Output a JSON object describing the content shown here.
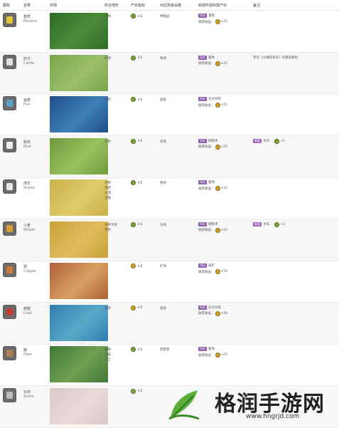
{
  "header": {
    "icon": "图标",
    "name": "名称",
    "appearance": "外观",
    "terrain": "所在地形",
    "yield": "产出指标",
    "improvement": "对应改良设施",
    "tech": "收获所需科技产出",
    "note": "备注"
  },
  "rows": [
    {
      "cn": "香蕉",
      "en": "Banana",
      "terrain": [
        "雨林"
      ],
      "yield": "+1",
      "improvement": "种植园",
      "tech_tag": "科技",
      "tech": "灌溉",
      "harvest": "收获收益：",
      "harvest_val": "+25",
      "note_tag": "",
      "note": "",
      "note_val": "",
      "icon_color": "#e6c630",
      "thumb": [
        "#2f6b2a",
        "#4d8b3a"
      ]
    },
    {
      "cn": "奶牛",
      "en": "Cattle",
      "terrain": [
        "草原"
      ],
      "yield": "+1",
      "improvement": "牧场",
      "tech_tag": "科技",
      "tech": "畜牧",
      "harvest": "收获收益：",
      "harvest_val": "+25",
      "note_tag": "",
      "note": "参见《大潮四号年》的建造教程",
      "note_val": "",
      "icon_color": "#e0e0e0",
      "thumb": [
        "#7aa54a",
        "#9bbf6a"
      ]
    },
    {
      "cn": "鱼群",
      "en": "Fish",
      "terrain": [
        "海岸"
      ],
      "yield": "+1",
      "improvement": "渔船",
      "tech_tag": "科技",
      "tech": "天文导航",
      "harvest": "收获收益：",
      "harvest_val": "+25",
      "note_tag": "",
      "note": "",
      "note_val": "",
      "icon_color": "#5aa0c8",
      "thumb": [
        "#1f4f8a",
        "#3e7fb8"
      ]
    },
    {
      "cn": "稻米",
      "en": "Rice",
      "terrain": [
        "草原"
      ],
      "yield": "+1",
      "improvement": "农场",
      "tech_tag": "科技",
      "tech": "制陶术",
      "harvest": "收获收益：",
      "harvest_val": "+25",
      "note_tag": "新版",
      "note": "水车：",
      "note_val": "+1",
      "icon_color": "#f0f0f0",
      "thumb": [
        "#6f9a3c",
        "#98c060"
      ]
    },
    {
      "cn": "绵羊",
      "en": "Sheep",
      "terrain": [
        "平原",
        "草原",
        "沙漠",
        "丘陵"
      ],
      "yield": "+1",
      "improvement": "牧场",
      "tech_tag": "科技",
      "tech": "畜牧",
      "harvest": "收获收益：",
      "harvest_val": "+25",
      "note_tag": "",
      "note": "",
      "note_val": "",
      "icon_color": "#e8e8e8",
      "thumb": [
        "#c9b04a",
        "#e0cb6a"
      ]
    },
    {
      "cn": "小麦",
      "en": "Wheat",
      "terrain": [
        "冲积平原",
        "平原"
      ],
      "yield": "+1",
      "improvement": "农场",
      "tech_tag": "科技",
      "tech": "制陶术",
      "harvest": "收获收益：",
      "harvest_val": "+25",
      "note_tag": "新版",
      "note": "水车：",
      "note_val": "+1",
      "icon_color": "#d8a030",
      "thumb": [
        "#c9a13a",
        "#e0bc5a"
      ]
    },
    {
      "cn": "铜",
      "en": "Copper",
      "terrain": [],
      "yield": "+2",
      "improvement": "矿场",
      "tech_tag": "科技",
      "tech": "采矿",
      "harvest": "收获收益：",
      "harvest_val": "+50",
      "note_tag": "",
      "note": "",
      "note_val": "",
      "icon_color": "#d07a40",
      "thumb": [
        "#b0603a",
        "#d8a060"
      ]
    },
    {
      "cn": "螃蟹",
      "en": "Crab",
      "terrain": [
        "海岸"
      ],
      "yield": "+2",
      "improvement": "渔船",
      "tech_tag": "科技",
      "tech": "天文导航",
      "harvest": "收获收益：",
      "harvest_val": "+50",
      "note_tag": "",
      "note": "",
      "note_val": "",
      "icon_color": "#c83a30",
      "thumb": [
        "#2f7fb0",
        "#5aa8c8"
      ]
    },
    {
      "cn": "鹿",
      "en": "Deer",
      "terrain": [
        "森林",
        "丘陵",
        "冻土"
      ],
      "yield": "+1",
      "improvement": "狩猎营",
      "tech_tag": "科技",
      "tech": "畜牧",
      "harvest": "收获收益：",
      "harvest_val": "+25",
      "note_tag": "",
      "note": "",
      "note_val": "",
      "icon_color": "#b08050",
      "thumb": [
        "#3f7a3a",
        "#6fa050"
      ]
    },
    {
      "cn": "石材",
      "en": "Stone",
      "terrain": [],
      "yield": "+1",
      "improvement": "",
      "tech_tag": "",
      "tech": "",
      "harvest": "",
      "harvest_val": "",
      "note_tag": "",
      "note": "",
      "note_val": "",
      "icon_color": "#bdbdbd",
      "thumb": [
        "#d8c8c8",
        "#eadada"
      ]
    }
  ],
  "watermark": {
    "title": "格润手游网",
    "url": "www.hngrjd.com"
  },
  "colors": {
    "accent_tag": "#8b5aa8",
    "gold": "#c9a227",
    "green": "#7fa33a"
  }
}
